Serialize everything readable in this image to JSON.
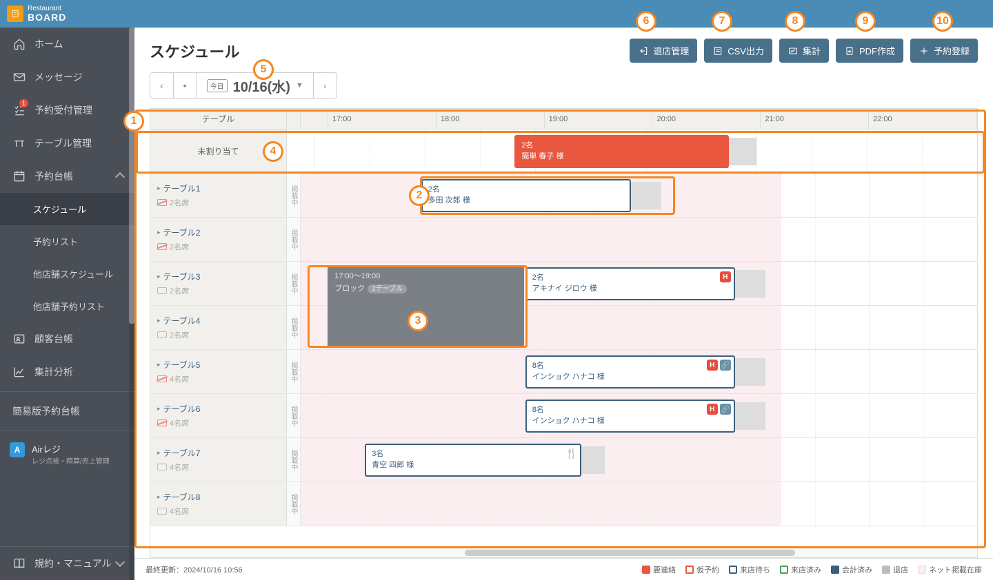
{
  "brand": {
    "name_small": "Restaurant",
    "name": "BOARD"
  },
  "sidebar": {
    "items": [
      {
        "label": "ホーム"
      },
      {
        "label": "メッセージ"
      },
      {
        "label": "予約受付管理",
        "badge": "1"
      },
      {
        "label": "テーブル管理"
      },
      {
        "label": "予約台帳"
      },
      {
        "label": "顧客台帳"
      },
      {
        "label": "集計分析"
      },
      {
        "label": "簡易版予約台帳"
      },
      {
        "label": "規約・マニュアル"
      }
    ],
    "sub_schedule": [
      {
        "label": "スケジュール"
      },
      {
        "label": "予約リスト"
      },
      {
        "label": "他店舗スケジュール"
      },
      {
        "label": "他店舗予約リスト"
      }
    ],
    "airregi": {
      "label": "Airレジ",
      "sub": "レジ点検・精算/売上管理"
    }
  },
  "page": {
    "title": "スケジュール"
  },
  "actions": {
    "leave": "退店管理",
    "csv": "CSV出力",
    "agg": "集計",
    "pdf": "PDF作成",
    "add": "予約登録"
  },
  "date_nav": {
    "today_chip": "今日",
    "date": "10/16(水)"
  },
  "timeline": {
    "table_header": "テーブル",
    "hours": [
      "17:00",
      "18:00",
      "19:00",
      "20:00",
      "21:00",
      "22:00"
    ],
    "unassigned_label": "未割り当て",
    "status_label": "掲載中",
    "tables": [
      {
        "name": "テーブル1",
        "seats": "2名席",
        "icon": "no-smoke"
      },
      {
        "name": "テーブル2",
        "seats": "2名席",
        "icon": "no-smoke"
      },
      {
        "name": "テーブル3",
        "seats": "2名席",
        "icon": "seat"
      },
      {
        "name": "テーブル4",
        "seats": "2名席",
        "icon": "seat"
      },
      {
        "name": "テーブル5",
        "seats": "4名席",
        "icon": "no-smoke"
      },
      {
        "name": "テーブル6",
        "seats": "4名席",
        "icon": "no-smoke"
      },
      {
        "name": "テーブル7",
        "seats": "4名席",
        "icon": "seat"
      },
      {
        "name": "テーブル8",
        "seats": "4名席",
        "icon": "seat"
      }
    ],
    "reservations": {
      "unassigned": {
        "guests": "2名",
        "name": "簡単 春子 様"
      },
      "t1": {
        "guests": "2名",
        "name": "多田 次郎 様"
      },
      "t3": {
        "guests": "2名",
        "name": "アキナイ ジロウ 様"
      },
      "t5": {
        "guests": "8名",
        "name": "インショク ハナコ 様"
      },
      "t6": {
        "guests": "8名",
        "name": "インショク ハナコ 様"
      },
      "t7": {
        "guests": "3名",
        "name": "青空 四郎 様"
      }
    },
    "block": {
      "time": "17:00〜19:00",
      "label": "ブロック",
      "chip": "2テーブル"
    }
  },
  "footer": {
    "updated": "最終更新：2024/10/16 10:56",
    "legend": {
      "need_contact": "要連絡",
      "tentative": "仮予約",
      "waiting": "来店待ち",
      "arrived": "来店済み",
      "paid": "会計済み",
      "left": "退店",
      "net_inventory": "ネット掲載在庫"
    }
  },
  "callouts": {
    "1": "1",
    "2": "2",
    "3": "3",
    "4": "4",
    "5": "5",
    "6": "6",
    "7": "7",
    "8": "8",
    "9": "9",
    "10": "10"
  }
}
